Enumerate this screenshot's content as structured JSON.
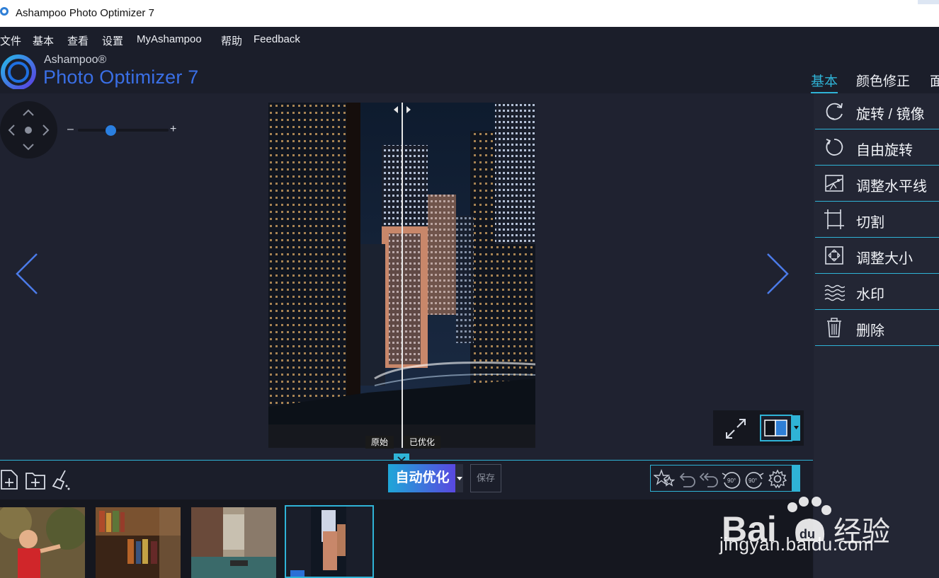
{
  "window": {
    "title": "Ashampoo Photo Optimizer 7"
  },
  "menu": [
    "文件",
    "基本",
    "查看",
    "设置",
    "MyAshampoo",
    "帮助",
    "Feedback"
  ],
  "logo": {
    "brand": "Ashampoo®",
    "product": "Photo Optimizer 7"
  },
  "tabs": [
    {
      "label": "基本",
      "active": true
    },
    {
      "label": "颜色修正",
      "active": false
    },
    {
      "label": "面",
      "active": false
    }
  ],
  "zoom": {
    "minus": "–",
    "plus": "+",
    "level_fraction": 0.36
  },
  "compare": {
    "original_label": "原始",
    "optimized_label": "已优化"
  },
  "toolbar": {
    "auto_optimize": "自动优化",
    "save": "保存",
    "rotate_left_label": "90°",
    "rotate_right_label": "90°"
  },
  "side_tools": [
    {
      "label": "旋转 / 镜像",
      "icon": "rotate-mirror-icon"
    },
    {
      "label": "自由旋转",
      "icon": "free-rotate-icon"
    },
    {
      "label": "调整水平线",
      "icon": "horizon-icon"
    },
    {
      "label": "切割",
      "icon": "crop-icon"
    },
    {
      "label": "调整大小",
      "icon": "resize-icon"
    },
    {
      "label": "水印",
      "icon": "watermark-icon"
    },
    {
      "label": "删除",
      "icon": "trash-icon"
    }
  ],
  "filmstrip": [
    {
      "name": "child-photo",
      "selected": false
    },
    {
      "name": "bookshelf-photo",
      "selected": false
    },
    {
      "name": "venice-canal-photo",
      "selected": false
    },
    {
      "name": "city-night-photo",
      "selected": true
    }
  ],
  "overlay_watermark": {
    "text": "jingyan.baidu.com",
    "brand": "Bai du 经验"
  },
  "colors": {
    "accent": "#2fb3d6",
    "background": "#1f2230",
    "panel": "#232634",
    "brand_blue": "#3a6fe6"
  }
}
